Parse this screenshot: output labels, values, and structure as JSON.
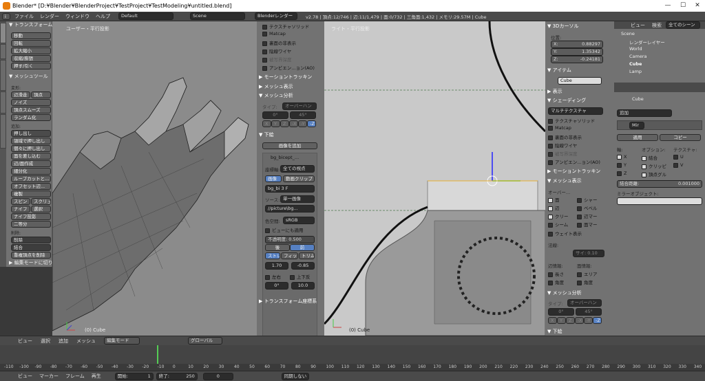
{
  "window": {
    "title": "Blender* [D:¥Blender¥BlenderProject¥TestProject¥TestModeling¥untitled.blend]",
    "controls": [
      "—",
      "☐",
      "✕"
    ]
  },
  "top_menu": {
    "items": [
      "ファイル",
      "レンダー",
      "ウィンドウ",
      "ヘルプ"
    ],
    "screen_layout": "Default",
    "scene": "Scene",
    "engine": "Blenderレンダー",
    "stats": "v2.78 | 頂点:12/746 | 辺:11/1,479 | 面:0/732 | 三角面:1,432 | メモリ:29.57M | Cube"
  },
  "tool_tabs": [
    "ツール",
    "作成",
    "シェーディング/UV",
    "オプション",
    "グリースペンシル"
  ],
  "toolshelf": {
    "transform_header": "▼ トランスフォーム",
    "transform_buttons": [
      "移動",
      "回転",
      "拡大縮小",
      "収縮/膨張",
      "押す/引く"
    ],
    "mesh_tools_header": "▼ メッシュツール",
    "deform_label": "変形:",
    "deform_buttons_pair": [
      "辺滑走",
      "頂点"
    ],
    "deform_buttons": [
      "ノイズ",
      "頂点スムーズ",
      "ランダム化"
    ],
    "add_label": "追加:",
    "add_buttons": [
      "押し出し",
      "領域で押し出し",
      "個々に押し出し",
      "面を差し込む",
      "辺/面作成",
      "細分化",
      "ループカットと...",
      "オフセット辺...",
      "複製"
    ],
    "pair1": [
      "スピン",
      "スクリュー"
    ],
    "pair2": [
      "ナイフ",
      "選択"
    ],
    "add_buttons2": [
      "ナイフ投影",
      "二等分"
    ],
    "remove_label": "削除:",
    "remove_dropdowns": [
      "削除",
      "結合"
    ],
    "remove_button": "重複頂点を削除",
    "mode_toggle": "▶ 編集モードに切り替え"
  },
  "viewport1": {
    "label": "ユーザー・平行投影",
    "object": "(0) Cube"
  },
  "npanel1": {
    "items": [
      {
        "label": "テクスチャソリッド",
        "checked": false
      },
      {
        "label": "Matcap",
        "checked": false
      },
      {
        "label": "裏面の非表示",
        "checked": false
      },
      {
        "label": "陰線ワイヤ",
        "checked": false
      },
      {
        "label": "被写界深度",
        "checked": false
      },
      {
        "label": "アンビエン...ョン(AO)",
        "checked": false
      }
    ],
    "motion_tracking": "▶ モーショントラッキン",
    "mesh_display": "▶ メッシュ表示",
    "mesh_analysis": "▼ メッシュ分析",
    "type_label": "タイプ:",
    "type_value": "オーバーハン",
    "deg_from": "0°",
    "deg_to": "45°",
    "axes": [
      "X",
      "Y",
      "Z",
      "-X",
      "-Y",
      "-Z"
    ],
    "background": "▼ 下絵",
    "add_image": "画像を追加",
    "image_name": "bg_bicept_...",
    "axis_label": "座標軸:",
    "axis_value": "全ての視点",
    "tab_image": "画像",
    "tab_clip": "動画クリップ",
    "file_name": "bg_bi",
    "file_users": "3",
    "file_flag": "F",
    "source_label": "ソース:",
    "source_value": "単一画像",
    "path": "//picture\\bg...",
    "colorspace_label": "色空間:",
    "colorspace_value": "sRGB",
    "view_as_render": "ビューにも適用",
    "opacity_label": "不透明度:",
    "opacity_value": "0.500",
    "back": "後",
    "front": "前",
    "fit_modes": [
      "ストレ",
      "フィット",
      "トリム"
    ],
    "offset_x": "1.70",
    "offset_y": "-0.85",
    "flip_x": "左右",
    "flip_y": "上下反",
    "rotation": "0°",
    "size": "10.0",
    "transform_orient": "▶ トランスフォーム座標系"
  },
  "viewport2": {
    "label": "ライト・平行投影",
    "object": "(0) Cube"
  },
  "npanel2": {
    "cursor_header": "▼ 3Dカーソル",
    "location_label": "位置:",
    "x": "0.88297",
    "y": "1.35342",
    "z": "-0.24181",
    "item_header": "▼ アイテム",
    "item_name": "Cube",
    "display_header": "▶ 表示",
    "shading_header": "▼ シェーディング",
    "shading_mode": "マルチテクスチャ",
    "shading_items": [
      "テクスチャソリッド",
      "Matcap",
      "裏面の非表示",
      "陰線ワイヤ",
      "被写界深度",
      "アンビエン...ョン(AO)"
    ],
    "motion_tracking": "▶ モーショントラッキン",
    "mesh_display": "▼ メッシュ表示",
    "overlay_label": "オーバー...",
    "overlay_items": [
      [
        "面",
        "シャー"
      ],
      [
        "辺",
        "ベベル"
      ],
      [
        "クリー",
        "辺マー"
      ],
      [
        "シーム",
        "面マー"
      ]
    ],
    "weight_display": "ウェイト表示",
    "normals_label": "法線:",
    "normal_size_label": "サイ: 0.10",
    "edge_info_label": "辺情報:",
    "face_info_label": "面情報:",
    "edge_info": [
      "長さ",
      "角度"
    ],
    "face_info": [
      "エリア",
      "角度"
    ],
    "mesh_analysis": "▼ メッシュ分析",
    "type_label": "タイプ:",
    "type_value": "オーバーハン",
    "deg_from": "0°",
    "deg_to": "45°",
    "axes": [
      "X",
      "Y",
      "Z",
      "-X",
      "-Y",
      "-Z"
    ],
    "background": "▼ 下絵"
  },
  "outliner": {
    "tabs": [
      "ビュー",
      "検索",
      "全てのシーン"
    ],
    "tree": [
      "Scene",
      "レンダーレイヤー",
      "World",
      "Camera",
      "Cube",
      "Lamp"
    ]
  },
  "properties": {
    "breadcrumb": "Cube",
    "add_modifier": "追加",
    "modifier_name": "Mir",
    "apply": "適用",
    "copy": "コピー",
    "axis_label": "軸:",
    "options_label": "オプション:",
    "texture_label": "テクスチャ:",
    "axis_items": [
      "X",
      "Y",
      "Z"
    ],
    "option_items": [
      "結合",
      "クリッピ",
      "頂点グル"
    ],
    "texture_items": [
      "U",
      "V"
    ],
    "merge_distance_label": "結合距離:",
    "merge_distance_value": "0.001000",
    "mirror_object_label": "ミラーオブジェクト:"
  },
  "view_header": {
    "items": [
      "ビュー",
      "選択",
      "追加",
      "メッシュ"
    ],
    "mode": "編集モード",
    "orientation": "グローバル"
  },
  "timeline": {
    "ticks": [
      "-110",
      "-100",
      "-90",
      "-80",
      "-70",
      "-60",
      "-50",
      "-40",
      "-30",
      "-20",
      "-10",
      "0",
      "10",
      "20",
      "30",
      "40",
      "50",
      "60",
      "70",
      "80",
      "90",
      "100",
      "110",
      "120",
      "130",
      "140",
      "150",
      "160",
      "170",
      "180",
      "190",
      "200",
      "210",
      "220",
      "230",
      "240",
      "250",
      "260",
      "270",
      "280",
      "290",
      "300",
      "310",
      "320",
      "330",
      "340"
    ],
    "menu": [
      "ビュー",
      "マーカー",
      "フレーム",
      "再生"
    ],
    "start_label": "開始:",
    "start_value": "1",
    "end_label": "終了:",
    "end_value": "250",
    "current": "0",
    "sync": "同期しない"
  }
}
